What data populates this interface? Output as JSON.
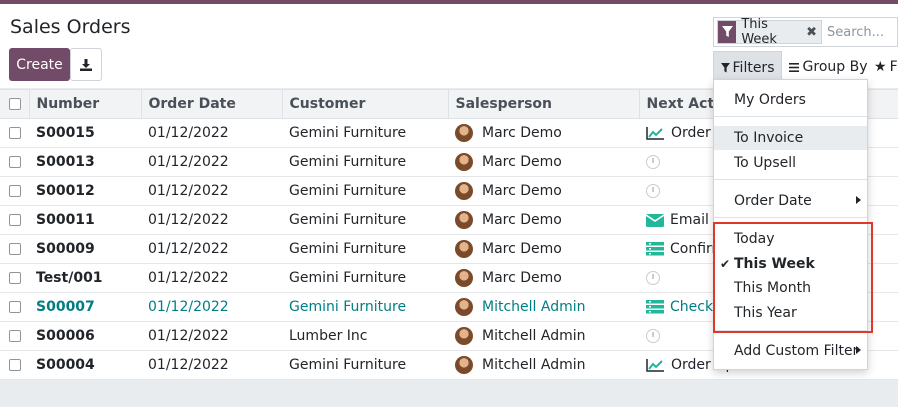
{
  "app": {
    "title": "Sales Orders",
    "create_label": "Create",
    "download_icon": "download-icon",
    "brand_color": "#714b67"
  },
  "search": {
    "facet_icon": "filter-icon",
    "facet_value": "This Week",
    "facet_remove": "✖",
    "placeholder": "Search..."
  },
  "toolbar": {
    "filters_label": "Filters",
    "groupby_label": "Group By",
    "favorites_label": "F"
  },
  "table": {
    "columns": [
      "Number",
      "Order Date",
      "Customer",
      "Salesperson",
      "Next Activity"
    ],
    "rows": [
      {
        "number": "S00015",
        "date": "01/12/2022",
        "customer": "Gemini Furniture",
        "salesperson": "Marc Demo",
        "activity_icon": "chart-icon",
        "activity": "Order Upsell"
      },
      {
        "number": "S00013",
        "date": "01/12/2022",
        "customer": "Gemini Furniture",
        "salesperson": "Marc Demo",
        "activity_icon": "clock-icon",
        "activity": ""
      },
      {
        "number": "S00012",
        "date": "01/12/2022",
        "customer": "Gemini Furniture",
        "salesperson": "Marc Demo",
        "activity_icon": "clock-icon",
        "activity": ""
      },
      {
        "number": "S00011",
        "date": "01/12/2022",
        "customer": "Gemini Furniture",
        "salesperson": "Marc Demo",
        "activity_icon": "email-icon",
        "activity": "Email"
      },
      {
        "number": "S00009",
        "date": "01/12/2022",
        "customer": "Gemini Furniture",
        "salesperson": "Marc Demo",
        "activity_icon": "tasks-icon",
        "activity": "Confirm"
      },
      {
        "number": "Test/001",
        "date": "01/12/2022",
        "customer": "Gemini Furniture",
        "salesperson": "Marc Demo",
        "activity_icon": "clock-icon",
        "activity": ""
      },
      {
        "number": "S00007",
        "date": "01/12/2022",
        "customer": "Gemini Furniture",
        "salesperson": "Mitchell Admin",
        "activity_icon": "tasks-icon",
        "activity": "Check o",
        "highlight": true
      },
      {
        "number": "S00006",
        "date": "01/12/2022",
        "customer": "Lumber Inc",
        "salesperson": "Mitchell Admin",
        "activity_icon": "clock-icon",
        "activity": ""
      },
      {
        "number": "S00004",
        "date": "01/12/2022",
        "customer": "Gemini Furniture",
        "salesperson": "Mitchell Admin",
        "activity_icon": "chart-icon",
        "activity": "Order Upsell"
      }
    ]
  },
  "filters_menu": {
    "items": [
      {
        "label": "My Orders"
      },
      {
        "label": "To Invoice"
      },
      {
        "label": "To Upsell"
      },
      {
        "label": "Order Date"
      },
      {
        "label": "Today"
      },
      {
        "label": "This Week",
        "selected": true
      },
      {
        "label": "This Month"
      },
      {
        "label": "This Year"
      },
      {
        "label": "Add Custom Filter"
      }
    ]
  },
  "colors": {
    "highlight_text": "#017e84",
    "activity_green": "#21b799",
    "annotation_red": "#e0372b"
  }
}
